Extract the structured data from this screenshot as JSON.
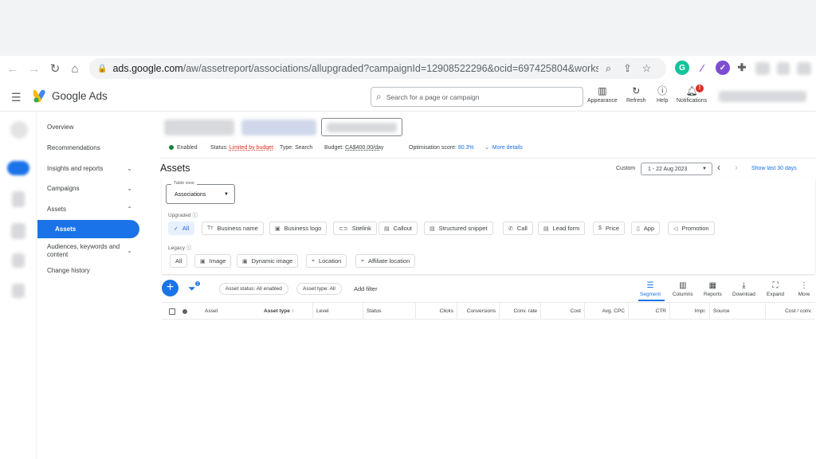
{
  "browser": {
    "url_host": "ads.google.com",
    "url_path": "/aw/assetreport/associations/allupgraded?campaignId=12908522296&ocid=697425804&workspaceId=0&...",
    "ext_grammarly": "G",
    "ext_2": "✓"
  },
  "header": {
    "brand": "Google Ads",
    "search_placeholder": "Search for a page or campaign",
    "tools": {
      "appearance": "Appearance",
      "refresh": "Refresh",
      "help": "Help",
      "notifications": "Notifications",
      "notif_badge": "!"
    }
  },
  "sidebar": {
    "items": [
      {
        "label": "Overview"
      },
      {
        "label": "Recommendations"
      },
      {
        "label": "Insights and reports"
      },
      {
        "label": "Campaigns"
      },
      {
        "label": "Assets"
      },
      {
        "label": "Assets"
      },
      {
        "label": "Audiences, keywords and content"
      },
      {
        "label": "Change history"
      }
    ]
  },
  "campaign": {
    "status": "Enabled",
    "status_label": "Status:",
    "status_value": "Limited by budget",
    "type_label": "Type:",
    "type_value": "Search",
    "budget_label": "Budget:",
    "budget_value": "CA$400.00/day",
    "opt_label": "Optimisation score:",
    "opt_value": "80.3%",
    "more_details": "More details"
  },
  "page": {
    "title": "Assets",
    "custom_label": "Custom",
    "date_range": "1 - 22 Aug 2023",
    "show_last": "Show last 30 days"
  },
  "filters": {
    "table_view_label": "Table view",
    "table_view_value": "Associations",
    "upgraded_label": "Upgraded",
    "upgraded_chips": [
      "All",
      "Business name",
      "Business logo",
      "Sitelink",
      "Callout",
      "Structured snippet",
      "Call",
      "Lead form",
      "Price",
      "App",
      "Promotion"
    ],
    "legacy_label": "Legacy",
    "legacy_chips": [
      "All",
      "Image",
      "Dynamic image",
      "Location",
      "Affiliate location"
    ]
  },
  "table": {
    "filter_badge": "2",
    "filter_chips": [
      "Asset status: All enabled",
      "Asset type: All"
    ],
    "add_filter": "Add filter",
    "tools": [
      "Segment",
      "Columns",
      "Reports",
      "Download",
      "Expand",
      "More"
    ],
    "columns": [
      "Asset",
      "Asset type",
      "Level",
      "Status",
      "Clicks",
      "Conversions",
      "Conv. rate",
      "Cost",
      "Avg. CPC",
      "CTR",
      "Impr.",
      "Source",
      "Cost / conv."
    ]
  },
  "colors": {
    "accent": "#1a73e8",
    "enabled": "#188038",
    "warning": "#d93025"
  }
}
